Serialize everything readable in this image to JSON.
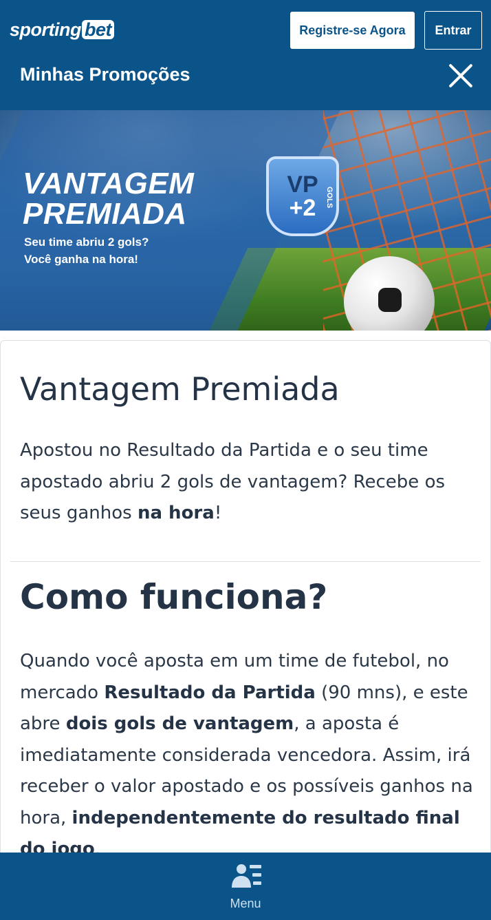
{
  "header": {
    "logo_part1": "sporting",
    "logo_part2": "bet",
    "register_label": "Registre-se Agora",
    "login_label": "Entrar",
    "page_title": "Minhas Promoções"
  },
  "banner": {
    "title_line1": "VANTAGEM",
    "title_line2": "PREMIADA",
    "subtitle_line1": "Seu time abriu 2 gols?",
    "subtitle_line2": "Você ganha na hora!",
    "badge_vp": "VP",
    "badge_plus2": "+2",
    "badge_gols": "GOLS"
  },
  "promo": {
    "title": "Vantagem Premiada",
    "intro_text": "Apostou no Resultado da Partida e o seu time apostado abriu 2 gols de vantagem? Recebe os seus ganhos ",
    "intro_bold": "na hora",
    "intro_end": "!",
    "how_title": "Como funciona?",
    "how_p1": "Quando você aposta em um time de futebol, no mercado ",
    "how_b1": "Resultado da Partida",
    "how_p2": " (90 mns), e este abre ",
    "how_b2": "dois gols de vantagem",
    "how_p3": ", a aposta é imediatamente considerada vencedora. Assim, irá receber o valor apostado e os possíveis ganhos na hora, ",
    "how_b3": "independentemente do resultado final do jogo",
    "how_p4": "."
  },
  "bottom_nav": {
    "menu_label": "Menu"
  },
  "colors": {
    "brand_blue": "#0b5489",
    "text_dark": "#253346"
  }
}
